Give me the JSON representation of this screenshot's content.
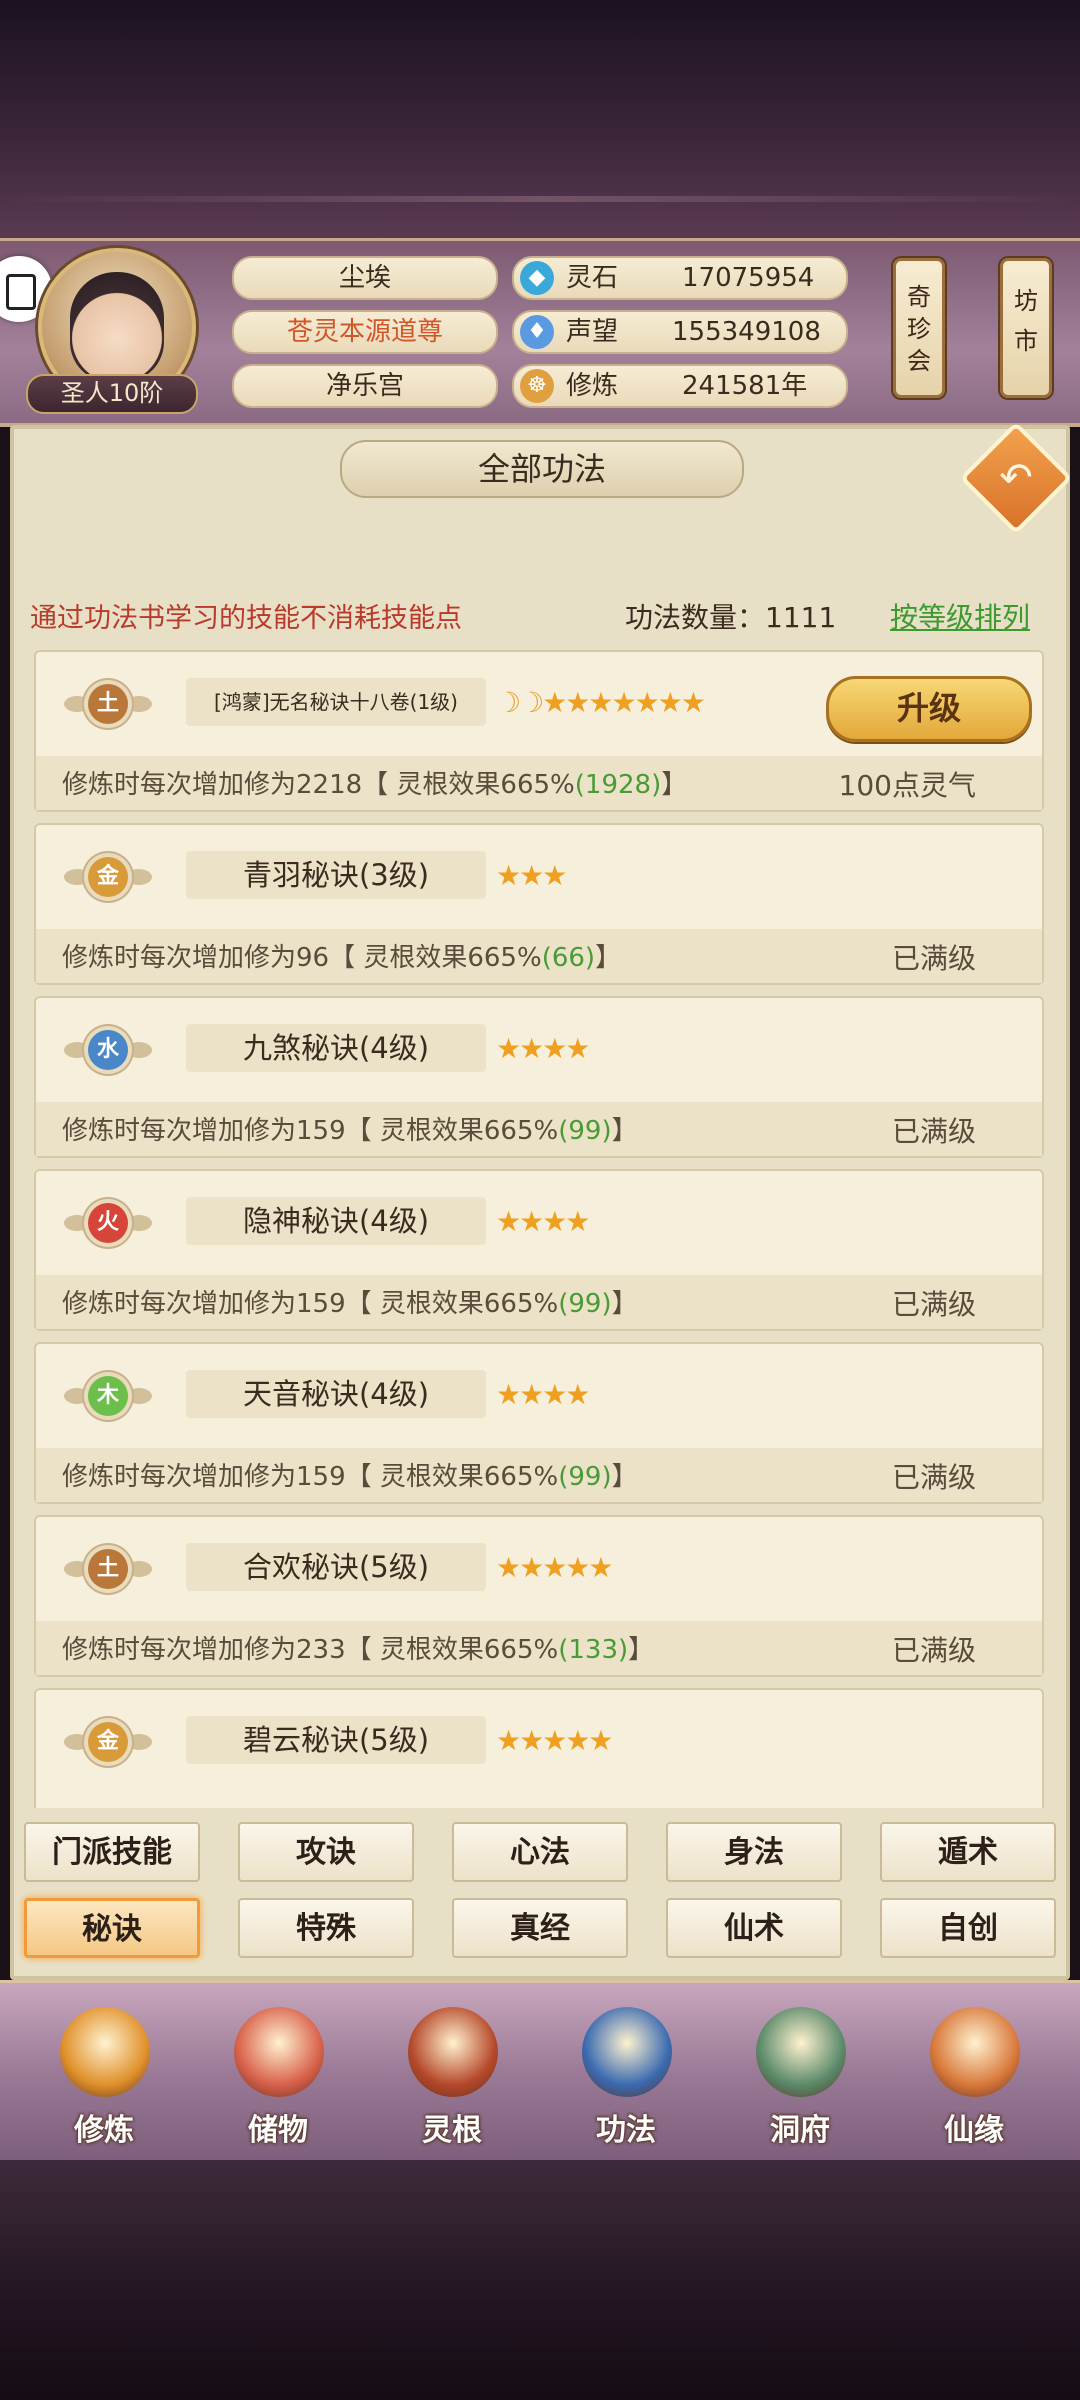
{
  "player": {
    "name": "尘埃",
    "title": "苍灵本源道尊",
    "sect": "净乐宫",
    "rank": "圣人10阶"
  },
  "stats": [
    {
      "icon": "spirit-stone-icon",
      "label": "灵石",
      "value": "17075954"
    },
    {
      "icon": "reputation-icon",
      "label": "声望",
      "value": "155349108"
    },
    {
      "icon": "cultivation-icon",
      "label": "修炼",
      "value": "241581年"
    }
  ],
  "side_buttons": [
    {
      "label": "奇珍会"
    },
    {
      "label": "坊市"
    }
  ],
  "panel": {
    "title": "全部功法",
    "notice": "通过功法书学习的技能不消耗技能点",
    "count_label": "功法数量：1111",
    "sort_label": "按等级排列"
  },
  "skills": [
    {
      "element": "土",
      "name": "[鸿蒙]无名秘诀十八卷(1级)",
      "moons": "☽☽",
      "stars": "★★★★★★★",
      "desc_prefix": "修炼时每次增加修为2218【 灵根效果665%",
      "desc_num": "(1928)",
      "desc_suffix": "】",
      "status": "100点灵气",
      "upgrade": "升级"
    },
    {
      "element": "金",
      "name": "青羽秘诀(3级)",
      "stars": "★★★",
      "desc_prefix": "修炼时每次增加修为96【 灵根效果665%",
      "desc_num": "(66)",
      "desc_suffix": "】",
      "status": "已满级"
    },
    {
      "element": "水",
      "name": "九煞秘诀(4级)",
      "stars": "★★★★",
      "desc_prefix": "修炼时每次增加修为159【 灵根效果665%",
      "desc_num": "(99)",
      "desc_suffix": "】",
      "status": "已满级"
    },
    {
      "element": "火",
      "name": "隐神秘诀(4级)",
      "stars": "★★★★",
      "desc_prefix": "修炼时每次增加修为159【 灵根效果665%",
      "desc_num": "(99)",
      "desc_suffix": "】",
      "status": "已满级"
    },
    {
      "element": "木",
      "name": "天音秘诀(4级)",
      "stars": "★★★★",
      "desc_prefix": "修炼时每次增加修为159【 灵根效果665%",
      "desc_num": "(99)",
      "desc_suffix": "】",
      "status": "已满级"
    },
    {
      "element": "土",
      "name": "合欢秘诀(5级)",
      "stars": "★★★★★",
      "desc_prefix": "修炼时每次增加修为233【 灵根效果665%",
      "desc_num": "(133)",
      "desc_suffix": "】",
      "status": "已满级"
    },
    {
      "element": "金",
      "name": "碧云秘诀(5级)",
      "stars": "★★★★★",
      "desc_prefix": "",
      "desc_num": "",
      "desc_suffix": "",
      "status": ""
    }
  ],
  "element_colors": {
    "土": "#b9773a",
    "金": "#d99a3a",
    "水": "#4a87c8",
    "火": "#d6453a",
    "木": "#6cbf4a"
  },
  "tabs": [
    {
      "label": "门派技能",
      "active": false
    },
    {
      "label": "攻诀",
      "active": false
    },
    {
      "label": "心法",
      "active": false
    },
    {
      "label": "身法",
      "active": false
    },
    {
      "label": "遁术",
      "active": false
    },
    {
      "label": "秘诀",
      "active": true
    },
    {
      "label": "特殊",
      "active": false
    },
    {
      "label": "真经",
      "active": false
    },
    {
      "label": "仙术",
      "active": false
    },
    {
      "label": "自创",
      "active": false
    }
  ],
  "nav": [
    {
      "label": "修炼",
      "icon": "monk-icon",
      "color": "#e0902a"
    },
    {
      "label": "储物",
      "icon": "bag-icon",
      "color": "#d8604a"
    },
    {
      "label": "灵根",
      "icon": "spirit-root-icon",
      "color": "#b5482a"
    },
    {
      "label": "功法",
      "icon": "book-icon",
      "color": "#3a6ab0"
    },
    {
      "label": "洞府",
      "icon": "cave-house-icon",
      "color": "#5a8a6a"
    },
    {
      "label": "仙缘",
      "icon": "gourd-icon",
      "color": "#d8783a"
    }
  ]
}
